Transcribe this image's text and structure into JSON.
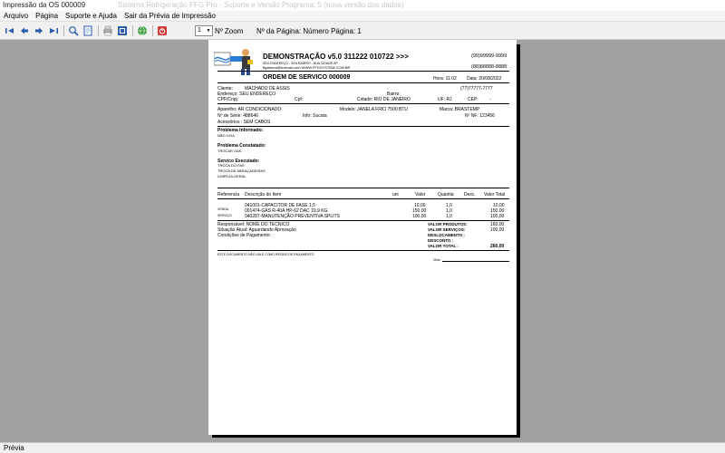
{
  "window": {
    "title": "Impressão da OS 000009",
    "title_ghost": "Sistema Refrigeração FFG Pro - Suporte e Versão Programa: 5 (nova versão dos dados)"
  },
  "menu": {
    "items": [
      "Arquivo",
      "Página",
      "Suporte e Ajuda",
      "Sair da Prévia de Impressão"
    ]
  },
  "toolbar": {
    "icons": [
      "first-page-icon",
      "prev-page-icon",
      "next-page-icon",
      "last-page-icon",
      "zoom-icon",
      "page-view-icon",
      "print-icon",
      "export-icon",
      "web-icon",
      "exit-icon"
    ],
    "page_select": "1",
    "zoom_label": "Nº Zoom",
    "page_label": "Nº da Página: Número Página: 1"
  },
  "status": {
    "text": "Prévia"
  },
  "doc": {
    "company": "DEMONSTRAÇÃO v5.0 311222 010722 >>>",
    "address": "SEU ENDEREÇO - SEU BAIRRO - SUA CIDADE-SP",
    "email_site": "ffgsistem@hotmail.com WWW.FFGSYSTEM.COM.BR",
    "phone1": "(99)99999-9999",
    "phone2": "(88)88888-8888",
    "os_title": "ORDEM DE SERVICO 000009",
    "time_label": "Hora: 11:02",
    "date_label": "Data: 20/08/2022",
    "client_label": "Cliente:",
    "client_name": "MACHADO DE ASSIS",
    "client_dash": "-",
    "client_phone": "(77)77777-7777",
    "address_label": "Endereço: SEU ENDEREÇO",
    "bairro_label": "Bairro:",
    "cpf_label": "CPF/Cnpj:",
    "ie_label": "Cpf:",
    "city_label": "Cidade: RIO DE JANEIRO",
    "uf_label": "UF: RJ",
    "cep_label": "CEP:",
    "cep_value": "-",
    "device_label": "Aparelho: AR CONDICIONADO",
    "model_label": "Modelo: JANELA FRIO 7500 BTU",
    "brand_label": "Marca: BRASTEMP",
    "serial_label": "Nº de Série: 488646",
    "info_label": "Info: Sucata",
    "nf_label": "Nº NF: 123456",
    "accessories_label": "Acessórios : SEM CABOS",
    "problem_inf_title": "Problema Informado:",
    "problem_inf_text": "NÃO LIGA",
    "problem_con_title": "Problema Constatado:",
    "problem_con_text": "TROCAR GAS",
    "service_title": "Servico Executado:",
    "service_lines": [
      "TROCA DO FAS",
      "TROCA DE ABRAÇADEIRAS",
      "LIMPEZA GERAL"
    ],
    "items_header": {
      "ref": "Referencia",
      "desc": "Descrição do Item",
      "un": "uni",
      "value": "Valor",
      "qty": "Quantia",
      "disc": "Desc.",
      "total": "Valor Total"
    },
    "group_labels": [
      "VENDA",
      "SERVIÇO"
    ],
    "items": [
      {
        "desc": "041001-CAPACITOR DE FASE 1,5",
        "value": "10,00",
        "qty": "1,0",
        "total": "10,00"
      },
      {
        "desc": "001474-GAS R-40A HP-62 DAC 10,9 KG",
        "value": "150,00",
        "qty": "1,0",
        "total": "150,00"
      },
      {
        "desc": "040287-MANUTENÇÃO PREVENTIVA SPLITS",
        "value": "100,00",
        "qty": "1,0",
        "total": "100,00"
      }
    ],
    "responsible": "Responsável: NOME DO TECNICO",
    "situation": "Situação Atual: Aguardando Aprovação",
    "payment": "Condições de Pagamento:",
    "totals": [
      {
        "label": "VALOR PRODUTOS:",
        "value": "160,00"
      },
      {
        "label": "VALOR SERVIÇOS:",
        "value": "100,00"
      },
      {
        "label": "DESLOCAMENTO :",
        "value": ""
      },
      {
        "label": "DESCONTO :",
        "value": ""
      },
      {
        "label": "VALOR TOTAL :",
        "value": "260,00"
      }
    ],
    "footer_note": "ESTE DOCUMENTO NÃO VALE COMO RECIBO DE PAGAMENTO",
    "visto_label": "Visto"
  }
}
